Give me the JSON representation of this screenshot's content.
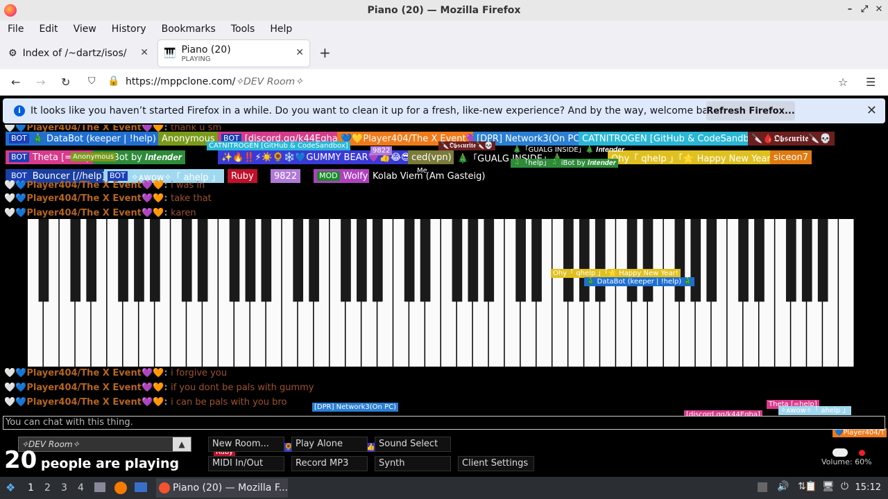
{
  "window": {
    "title": "Piano (20) — Mozilla Firefox"
  },
  "menu": [
    "File",
    "Edit",
    "View",
    "History",
    "Bookmarks",
    "Tools",
    "Help"
  ],
  "tabs": [
    {
      "title": "Index of /~dartz/isos/"
    },
    {
      "title": "Piano (20)",
      "subtitle": "PLAYING"
    }
  ],
  "nav": {
    "url_main": "https://mppclone.com/",
    "url_room": "✧𝘋𝘌𝘝 𝘙𝘰𝘰𝘮✧"
  },
  "notice": {
    "text": "It looks like you haven’t started Firefox in a while. Do you want to clean it up for a fresh, like-new experience? And by the way, welcome back!",
    "button": "Refresh Firefox..."
  },
  "users_row1": [
    {
      "badge": "BOT",
      "name": "🎄 DataBot (keeper | !help) 🎄",
      "color": "#1f6fd1"
    },
    {
      "name": "Anonymous",
      "color": "#7a9a1a"
    },
    {
      "badge": "BOT",
      "name": "[discord.gg/k44Eqha]",
      "color": "#d63b8a"
    },
    {
      "name": "💙💛Player404/The X Event💜🧡",
      "color": "#f07a1a"
    },
    {
      "name": "[DPR] Network3(On PC)",
      "color": "#2a7fd4"
    },
    {
      "name": "CATNITROGEN [GitHub & CodeSandbox]",
      "color": "#2ab7d6"
    },
    {
      "name": "🔪🩸𝕺𝖇𝖘𝖈𝖚𝖗𝖎𝖙𝖊🔪💀",
      "color": "#6b1f1f"
    }
  ],
  "users_row2": [
    {
      "badge": "BOT",
      "name": "Theta [=help]",
      "color": "#d83a8c"
    },
    {
      "name": "🎄 iBot by 𝑰𝒏𝒕𝒆𝒏𝒅𝒆𝒓",
      "color": "#2e8b3a"
    },
    {
      "name": "✨🔥‼️⚡☀️🌻❄️💙GUMMY BEAR💜👍😂😎😊",
      "color": "#3a3ad6"
    },
    {
      "name": "ced(vpn)",
      "color": "#7a7a3a"
    },
    {
      "name": "🎄「GUALG INSIDE」🎄",
      "color": "#000000"
    },
    {
      "name": "Ohy「 qhelp 」「🌟 Happy New Year! 」",
      "color": "#e0c020"
    },
    {
      "name": "siceon7",
      "color": "#e07a10"
    }
  ],
  "users_row3": [
    {
      "badge": "BOT",
      "name": "Bouncer [//help]",
      "color": "#1a3fa0"
    },
    {
      "badge": "BOT",
      "name": "✧ᴀᴡᴏᴡ✧「 ahelp 」",
      "color": "#a0d8f0"
    },
    {
      "name": "Ruby",
      "color": "#c0102a"
    },
    {
      "name": "9822",
      "color": "#b07ad8"
    },
    {
      "badge": "MOD",
      "name": "Wolfy",
      "color": "#b040c0"
    },
    {
      "name": "Kolab Viem (Am Gasteig)",
      "color": "#000000"
    }
  ],
  "cursor_labels": [
    {
      "text": "Anonymous",
      "color": "#7a9a1a"
    },
    {
      "text": "CATNITROGEN [GitHub & CodeSandbox]",
      "color": "#2ab7d6"
    },
    {
      "text": "9822",
      "color": "#b07ad8"
    },
    {
      "text": "🔪𝕺𝖇𝖘𝖈𝖚𝖗𝖎𝖙𝖊🔪💀",
      "color": "#6b1f1f"
    },
    {
      "text": "🎄「GUALG INSIDE」🎄 𝑰𝒏𝒕𝒆𝒏𝒅𝒆𝒓",
      "color": "#000000"
    },
    {
      "text": "🎄「help」🎄 iBot by 𝑰𝒏𝒕𝒆𝒏𝒅𝒆𝒓",
      "color": "#2e8b3a"
    },
    {
      "text": "Me",
      "color": "#000000"
    },
    {
      "text": "Ohy「 qhelp 」「🌟 Happy New Year!",
      "color": "#e0c020"
    },
    {
      "text": "🎄 DataBot (keeper | !help) 🎄",
      "color": "#1f6fd1"
    },
    {
      "text": "[DPR] Network3(On PC)",
      "color": "#2a7fd4"
    },
    {
      "text": "[discord.gg/k44Eqha]",
      "color": "#d63b8a"
    },
    {
      "text": "Theta [=help]",
      "color": "#d83a8c"
    },
    {
      "text": "✧ᴀᴡᴏᴡ✧「 ahelp 」",
      "color": "#a0d8f0"
    },
    {
      "text": "💙Player404/T",
      "color": "#f07a1a"
    },
    {
      "text": "✨🔥‼️⚡☀️🌻❄️💙GUMMY BEAR💜👍😂😎😊",
      "color": "#3a3ad6"
    },
    {
      "text": "Ruby",
      "color": "#c0102a"
    }
  ],
  "chat": [
    {
      "name": "Player404/The X Event",
      "msg": "thank u sm"
    },
    {
      "name": "Player404/The X Event",
      "msg": "i was in"
    },
    {
      "name": "Player404/The X Event",
      "msg": "take that"
    },
    {
      "name": "Player404/The X Event",
      "msg": "karen"
    },
    {
      "name": "Player404/The X Event",
      "msg": "i forgive you"
    },
    {
      "name": "Player404/The X Event",
      "msg": "if you dont be pals with gummy"
    },
    {
      "name": "Player404/The X Event",
      "msg": "i can be pals with you bro"
    }
  ],
  "chat_placeholder": "You can chat with this thing.",
  "room": {
    "name": "✧𝘋𝘌𝘝 𝘙𝘰𝘰𝘮✧"
  },
  "players": {
    "count": "20",
    "label": "people are playing"
  },
  "buttons": {
    "new_room": "New Room...",
    "play_alone": "Play Alone",
    "sound_select": "Sound Select",
    "midi": "MIDI In/Out",
    "record": "Record MP3",
    "synth": "Synth",
    "client_settings": "Client Settings"
  },
  "volume": "Volume: 60%",
  "taskbar": {
    "workspaces": [
      "1",
      "2",
      "3",
      "4"
    ],
    "active": "Piano (20) — Mozilla F...",
    "clock": "15:12"
  }
}
